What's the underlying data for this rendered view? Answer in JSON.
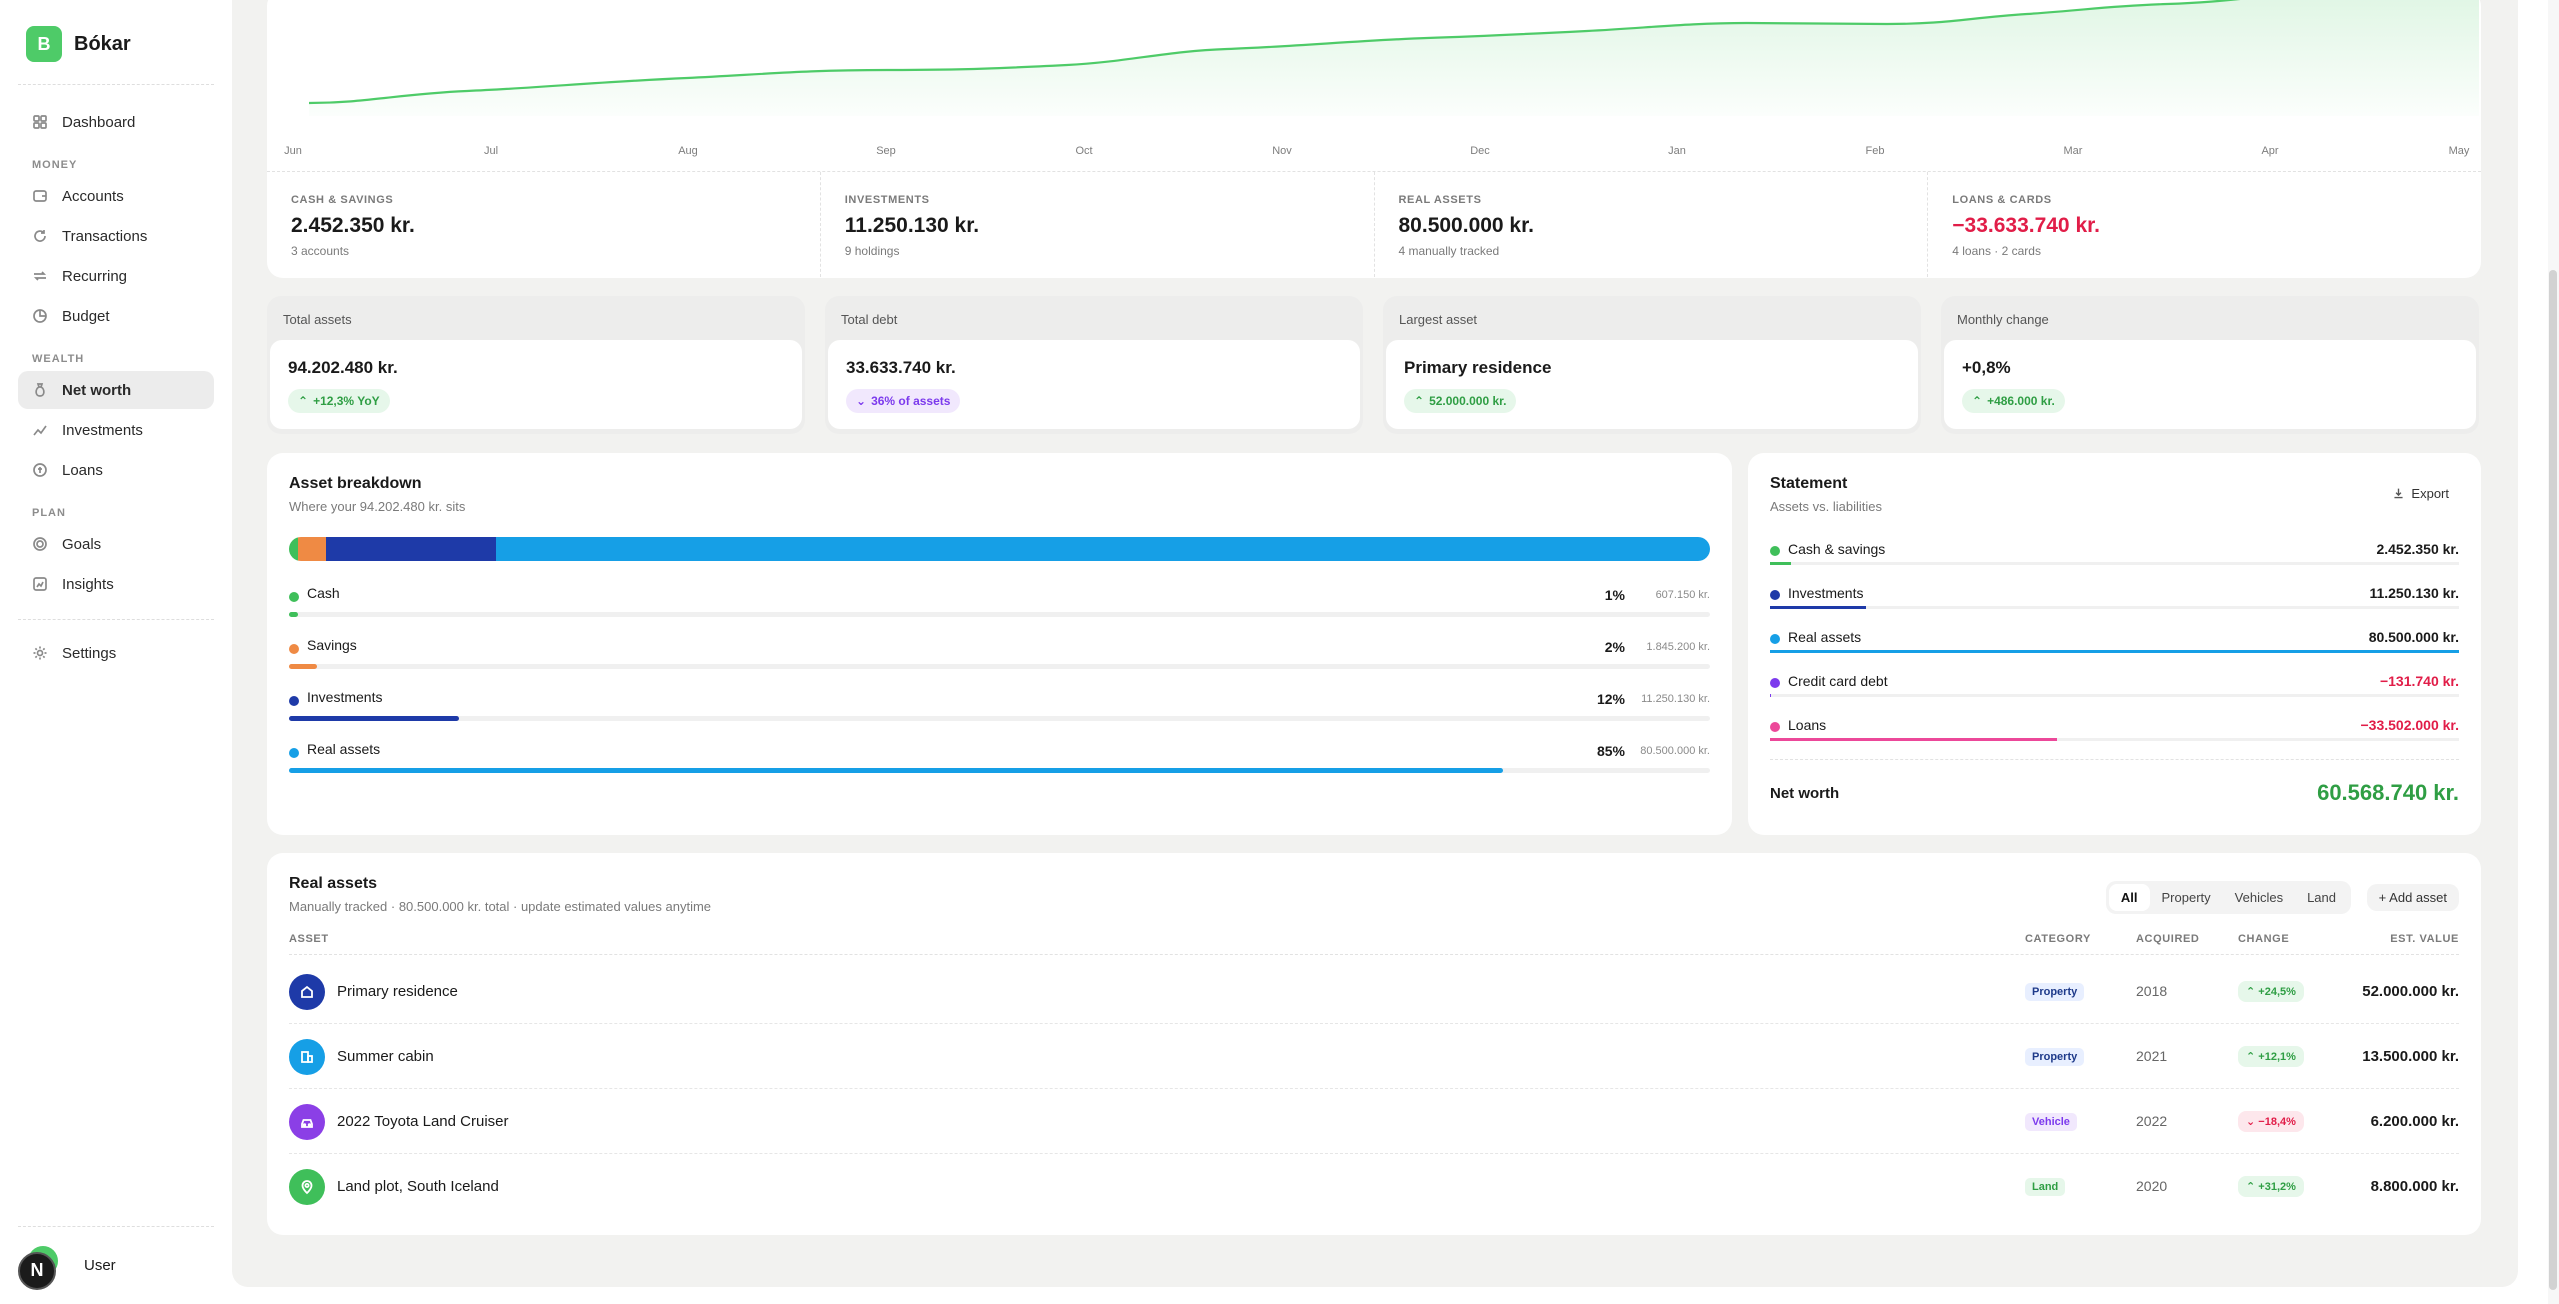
{
  "brand": {
    "logo_letter": "B",
    "name": "Bókar"
  },
  "sidebar": {
    "dashboard": "Dashboard",
    "sections": {
      "money": "MONEY",
      "wealth": "WEALTH",
      "plan": "PLAN"
    },
    "money": [
      "Accounts",
      "Transactions",
      "Recurring",
      "Budget"
    ],
    "wealth": [
      "Net worth",
      "Investments",
      "Loans"
    ],
    "plan": [
      "Goals",
      "Insights"
    ],
    "settings": "Settings",
    "user": {
      "initial": "N",
      "name": "User"
    }
  },
  "trend_chart": {
    "months": [
      "Jun",
      "Jul",
      "Aug",
      "Sep",
      "Oct",
      "Nov",
      "Dec",
      "Jan",
      "Feb",
      "Mar",
      "Apr",
      "May"
    ],
    "line_color": "#4ecb68"
  },
  "summary": [
    {
      "label": "CASH & SAVINGS",
      "value": "2.452.350 kr.",
      "sub": "3 accounts",
      "negative": false
    },
    {
      "label": "INVESTMENTS",
      "value": "11.250.130 kr.",
      "sub": "9 holdings",
      "negative": false
    },
    {
      "label": "REAL ASSETS",
      "value": "80.500.000 kr.",
      "sub": "4 manually tracked",
      "negative": false
    },
    {
      "label": "LOANS & CARDS",
      "value": "−33.633.740 kr.",
      "sub": "4 loans · 2 cards",
      "negative": true
    }
  ],
  "kpis": [
    {
      "label": "Total assets",
      "value": "94.202.480 kr.",
      "badge": "+12,3% YoY",
      "badge_tone": "green",
      "badge_icon": "chevron-up"
    },
    {
      "label": "Total debt",
      "value": "33.633.740 kr.",
      "badge": "36% of assets",
      "badge_tone": "purple",
      "badge_icon": "chevron-down"
    },
    {
      "label": "Largest asset",
      "value": "Primary residence",
      "badge": "52.000.000 kr.",
      "badge_tone": "green",
      "badge_icon": "chevron-up"
    },
    {
      "label": "Monthly change",
      "value": "+0,8%",
      "badge": "+486.000 kr.",
      "badge_tone": "green",
      "badge_icon": "chevron-up"
    }
  ],
  "breakdown": {
    "title": "Asset breakdown",
    "subtitle": "Where your 94.202.480 kr. sits",
    "items": [
      {
        "name": "Cash",
        "pct": "1%",
        "share": 0.0064,
        "amount": "607.150 kr.",
        "color": "#3fbf5a"
      },
      {
        "name": "Savings",
        "pct": "2%",
        "share": 0.0196,
        "amount": "1.845.200 kr.",
        "color": "#ef8a44"
      },
      {
        "name": "Investments",
        "pct": "12%",
        "share": 0.1194,
        "amount": "11.250.130 kr.",
        "color": "#1e3aa8"
      },
      {
        "name": "Real assets",
        "pct": "85%",
        "share": 0.8546,
        "amount": "80.500.000 kr.",
        "color": "#169fe6"
      }
    ]
  },
  "statement": {
    "title": "Statement",
    "subtitle": "Assets vs. liabilities",
    "export_label": "Export",
    "rows": [
      {
        "name": "Cash & savings",
        "value": "2.452.350 kr.",
        "negative": false,
        "color": "#3fbf5a",
        "share": 0.0305
      },
      {
        "name": "Investments",
        "value": "11.250.130 kr.",
        "negative": false,
        "color": "#1e3aa8",
        "share": 0.1398
      },
      {
        "name": "Real assets",
        "value": "80.500.000 kr.",
        "negative": false,
        "color": "#169fe6",
        "share": 1.0
      },
      {
        "name": "Credit card debt",
        "value": "−131.740 kr.",
        "negative": true,
        "color": "#7c3aed",
        "share": 0.0016
      },
      {
        "name": "Loans",
        "value": "−33.502.000 kr.",
        "negative": true,
        "color": "#ec4899",
        "share": 0.4162
      }
    ],
    "net_label": "Net worth",
    "net_value": "60.568.740 kr."
  },
  "real_assets": {
    "title": "Real assets",
    "subtitle": "Manually tracked · 80.500.000 kr. total · update estimated values anytime",
    "filters": [
      "All",
      "Property",
      "Vehicles",
      "Land"
    ],
    "active_filter": "All",
    "add_label": "Add asset",
    "columns": {
      "asset": "ASSET",
      "category": "CATEGORY",
      "acquired": "ACQUIRED",
      "change": "CHANGE",
      "value": "EST. VALUE"
    },
    "rows": [
      {
        "name": "Primary residence",
        "icon": "home-icon",
        "icon_color": "#1e3aa8",
        "category": "Property",
        "cat_class": "property",
        "acquired": "2018",
        "change": "+24,5%",
        "direction": "up",
        "value": "52.000.000 kr."
      },
      {
        "name": "Summer cabin",
        "icon": "building-icon",
        "icon_color": "#169fe6",
        "category": "Property",
        "cat_class": "property",
        "acquired": "2021",
        "change": "+12,1%",
        "direction": "up",
        "value": "13.500.000 kr."
      },
      {
        "name": "2022 Toyota Land Cruiser",
        "icon": "car-icon",
        "icon_color": "#8b3fe6",
        "category": "Vehicle",
        "cat_class": "vehicle",
        "acquired": "2022",
        "change": "−18,4%",
        "direction": "down",
        "value": "6.200.000 kr."
      },
      {
        "name": "Land plot, South Iceland",
        "icon": "map-pin-icon",
        "icon_color": "#3fbf5a",
        "category": "Land",
        "cat_class": "land",
        "acquired": "2020",
        "change": "+31,2%",
        "direction": "up",
        "value": "8.800.000 kr."
      }
    ]
  }
}
